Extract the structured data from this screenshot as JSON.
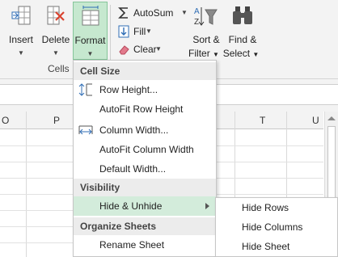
{
  "ribbon": {
    "insert": {
      "label": "Insert",
      "icon": "insert-cells-icon"
    },
    "delete": {
      "label": "Delete",
      "icon": "delete-cells-icon"
    },
    "format": {
      "label": "Format",
      "icon": "format-cells-icon"
    },
    "cells_group_label": "Cells",
    "autosum": {
      "label": "AutoSum",
      "icon": "sigma-icon"
    },
    "fill": {
      "label": "Fill",
      "icon": "fill-down-icon"
    },
    "clear": {
      "label": "Clear",
      "icon": "eraser-icon"
    },
    "sort_filter": {
      "label1": "Sort &",
      "label2": "Filter",
      "icon": "sort-filter-icon"
    },
    "find_select": {
      "label1": "Find &",
      "label2": "Select",
      "icon": "binoculars-icon"
    }
  },
  "grid": {
    "columns": [
      "O",
      "P",
      "T",
      "U"
    ]
  },
  "format_menu": {
    "sections": {
      "cell_size": "Cell Size",
      "visibility": "Visibility",
      "organize_sheets": "Organize Sheets"
    },
    "items": {
      "row_height": "Row Height...",
      "autofit_row_height": "AutoFit Row Height",
      "column_width": "Column Width...",
      "autofit_column_width": "AutoFit Column Width",
      "default_width": "Default Width...",
      "hide_unhide": "Hide & Unhide",
      "rename_sheet": "Rename Sheet"
    }
  },
  "hide_submenu": {
    "items": [
      "Hide Rows",
      "Hide Columns",
      "Hide Sheet"
    ]
  },
  "colors": {
    "accent_green": "#c6e8cf",
    "highlight_green": "#d3ecdb",
    "delete_red": "#d9432f",
    "icon_blue": "#2f6db5"
  }
}
